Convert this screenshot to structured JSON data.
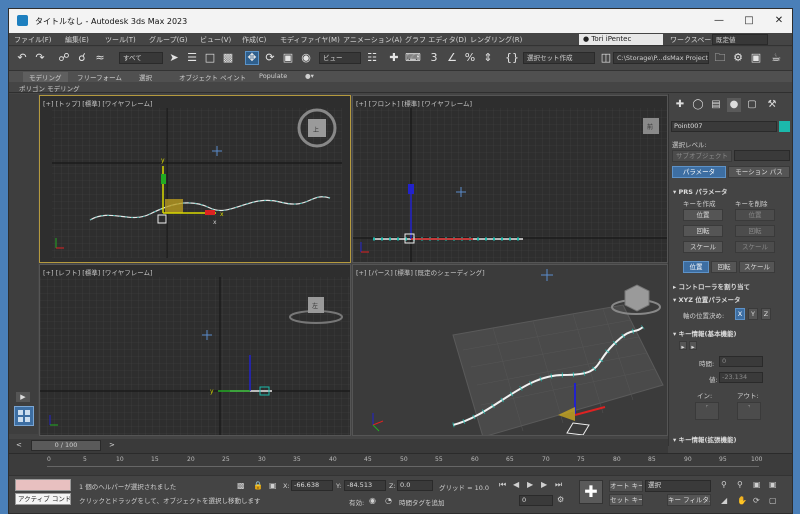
{
  "window": {
    "title": "タイトルなし - Autodesk 3ds Max 2023"
  },
  "menu": [
    "ファイル(F)",
    "編集(E)",
    "ツール(T)",
    "グループ(G)",
    "ビュー(V)",
    "作成(C)",
    "モディファイヤ(M)",
    "アニメーション(A)",
    "グラフ エディタ(D)",
    "レンダリング(R)"
  ],
  "account": {
    "user": "Tori iPentec",
    "workspace_label": "ワークスペース:",
    "workspace_value": "既定値"
  },
  "toolbar": {
    "filter": "すべて",
    "refcoord": "ビュー",
    "named_selection": "選択セット作成",
    "project_path": "C:\\Storage\\P...dsMax Project"
  },
  "ribbon": {
    "tabs": [
      "モデリング",
      "フリーフォーム",
      "選択",
      "オブジェクト ペイント",
      "Populate"
    ],
    "subtab": "ポリゴン モデリング"
  },
  "viewports": [
    {
      "label": "[+] [トップ] [標準] [ワイヤフレーム]",
      "viewcube": "上"
    },
    {
      "label": "[+] [フロント] [標準] [ワイヤフレーム]",
      "viewcube": "前"
    },
    {
      "label": "[+] [レフト] [標準] [ワイヤフレーム]",
      "viewcube": "左"
    },
    {
      "label": "[+] [パース] [標準] [既定のシェーディング]",
      "viewcube": ""
    }
  ],
  "command_panel": {
    "object_name": "Point007",
    "selection_level_label": "選択レベル:",
    "subobject": "サブオブジェクト",
    "btn_params": "パラメータ",
    "btn_motion_path": "モーション パス",
    "prs_header": "PRS パラメータ",
    "create_key": "キーを作成",
    "delete_key": "キーを削除",
    "create_buttons": [
      "位置",
      "回転",
      "スケール"
    ],
    "delete_buttons": [
      "位置",
      "回転",
      "スケール"
    ],
    "mode_buttons": [
      "位置",
      "回転",
      "スケール"
    ],
    "controller_header": "コントローラを割り当て",
    "xyz_header": "XYZ 位置パラメータ",
    "axis_label": "軸の位置決め:",
    "axes": [
      "X",
      "Y",
      "Z"
    ],
    "key_basic_header": "キー情報(基本機能)",
    "time_label": "時間:",
    "time_value": "0",
    "value_label": "値:",
    "value_value": "-23.134",
    "in_label": "イン:",
    "out_label": "アウト:",
    "key_adv_header": "キー情報(拡張機能)"
  },
  "timeline": {
    "slider": "0 / 100",
    "ticks": [
      "0",
      "5",
      "10",
      "15",
      "20",
      "25",
      "30",
      "35",
      "40",
      "45",
      "50",
      "55",
      "60",
      "65",
      "70",
      "75",
      "80",
      "85",
      "90",
      "95",
      "100"
    ]
  },
  "status": {
    "mode": "アクティブ コンド",
    "message1": "1 個のヘルパーが選択されました",
    "message2": "クリックとドラッグをして、オブジェクトを選択し移動します",
    "x_label": "X:",
    "x": "-66.638",
    "y_label": "Y:",
    "y": "-84.513",
    "z_label": "Z:",
    "z": "0.0",
    "grid": "グリッド = 10.0",
    "enabled": "有効:",
    "add_time_tag": "時間タグを追加",
    "auto_key": "オート キー",
    "set_key": "セット キー",
    "selected": "選択",
    "key_filter": "キー フィルタ...",
    "frame": "0"
  },
  "colors": {
    "accent": "#2f5f8c",
    "active_viewport_border": "#b59a3e",
    "object_color": "#1bb9ab"
  }
}
